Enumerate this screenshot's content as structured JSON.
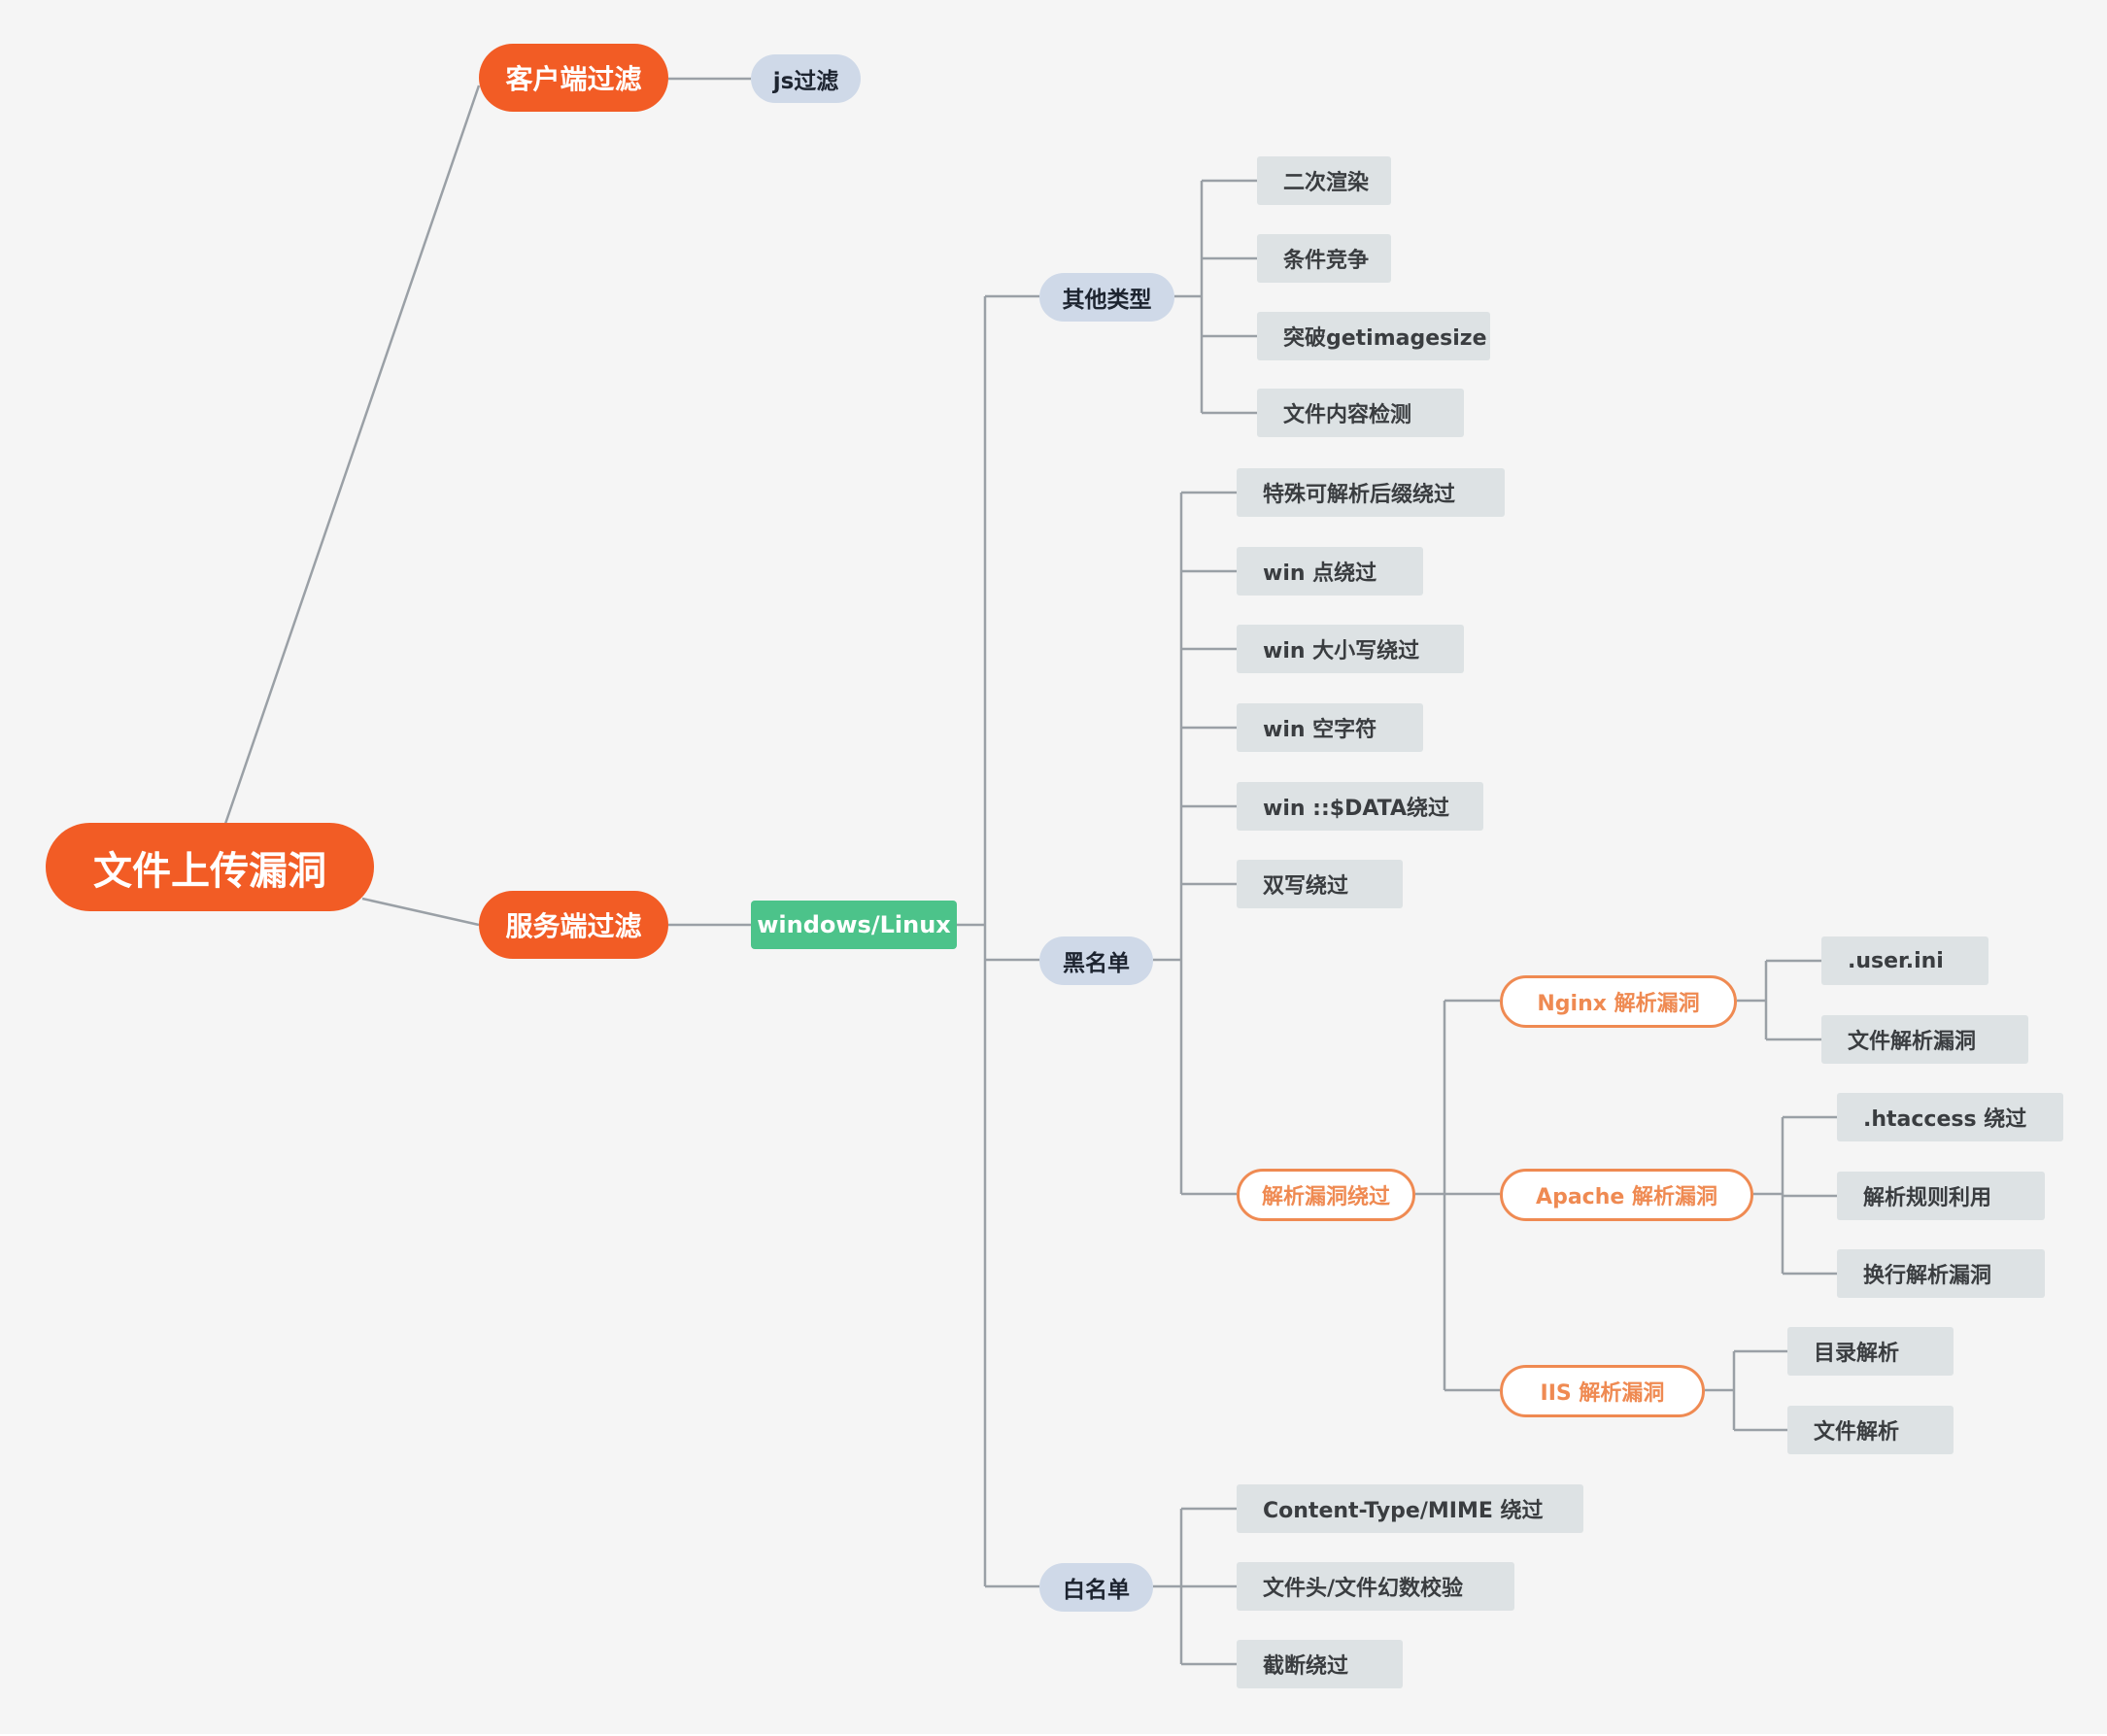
{
  "colors": {
    "background": "#f5f5f5",
    "line": "#9aa0a6",
    "primary_orange": "#f25c25",
    "pill_blue": "#cfd9e8",
    "green": "#4cc38a",
    "leaf_gray": "#dde2e4",
    "outline_orange": "#ef8a52"
  },
  "mindmap": {
    "root": "文件上传漏洞",
    "client": {
      "label": "客户端过滤",
      "children": [
        "js过滤"
      ]
    },
    "server": {
      "label": "服务端过滤",
      "platform": "windows/Linux",
      "other": {
        "label": "其他类型",
        "items": [
          "二次渲染",
          "条件竞争",
          "突破getimagesize",
          "文件内容检测"
        ]
      },
      "blacklist": {
        "label": "黑名单",
        "items": [
          "特殊可解析后缀绕过",
          "win 点绕过",
          "win 大小写绕过",
          "win 空字符",
          "win ::$DATA绕过",
          "双写绕过"
        ],
        "parse": {
          "label": "解析漏洞绕过",
          "nginx": {
            "label": "Nginx 解析漏洞",
            "items": [
              ".user.ini",
              "文件解析漏洞"
            ]
          },
          "apache": {
            "label": "Apache 解析漏洞",
            "items": [
              ".htaccess 绕过",
              "解析规则利用",
              "换行解析漏洞"
            ]
          },
          "iis": {
            "label": "IIS 解析漏洞",
            "items": [
              "目录解析",
              "文件解析"
            ]
          }
        }
      },
      "whitelist": {
        "label": "白名单",
        "items": [
          "Content-Type/MIME 绕过",
          "文件头/文件幻数校验",
          "截断绕过"
        ]
      }
    }
  }
}
